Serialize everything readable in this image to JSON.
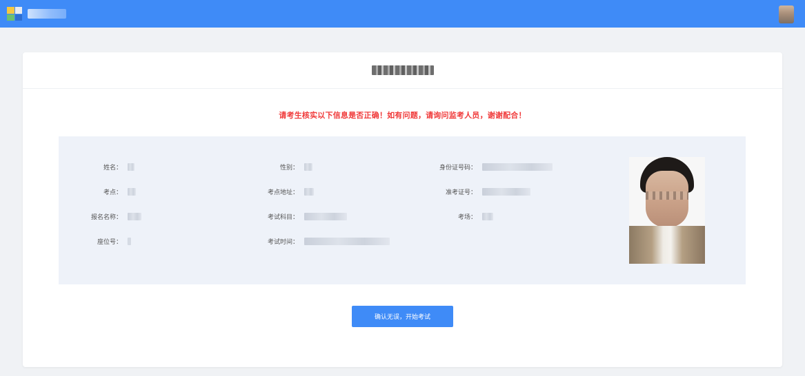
{
  "header": {
    "logo_icon": "app-logo-icon",
    "avatar_icon": "user-avatar-icon",
    "bar_color": "#3f8bf7"
  },
  "notice": {
    "text": "请考生核实以下信息是否正确！如有问题，请询问监考人员，谢谢配合！",
    "color": "#f03a3a"
  },
  "info": {
    "fields": [
      {
        "key": "name",
        "label": "姓名："
      },
      {
        "key": "gender",
        "label": "性别："
      },
      {
        "key": "id_number",
        "label": "身份证号码："
      },
      {
        "key": "exam_site",
        "label": "考点："
      },
      {
        "key": "exam_site_address",
        "label": "考点地址："
      },
      {
        "key": "admission_number",
        "label": "准考证号："
      },
      {
        "key": "registration_name",
        "label": "报名名称："
      },
      {
        "key": "exam_subject",
        "label": "考试科目："
      },
      {
        "key": "exam_room",
        "label": "考场："
      },
      {
        "key": "seat_number",
        "label": "座位号："
      },
      {
        "key": "exam_time",
        "label": "考试时间："
      }
    ]
  },
  "actions": {
    "confirm_label": "确认无误，开始考试"
  }
}
